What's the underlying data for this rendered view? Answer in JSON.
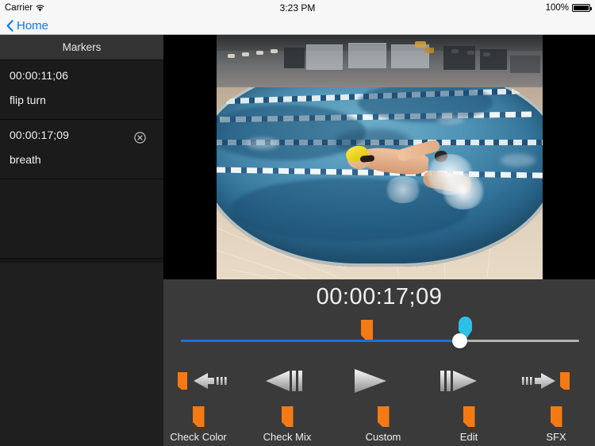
{
  "status_bar": {
    "carrier": "Carrier",
    "wifi_icon": "wifi-icon",
    "time": "3:23 PM",
    "battery_percent": "100%",
    "battery_icon": "battery-full-icon"
  },
  "nav_bar": {
    "back_icon": "chevron-left-icon",
    "back_label": "Home"
  },
  "sidebar": {
    "header": "Markers",
    "markers": [
      {
        "timecode": "00:00:11;06",
        "label": "flip turn",
        "has_delete": false
      },
      {
        "timecode": "00:00:17;09",
        "label": "breath",
        "has_delete": true,
        "delete_icon": "circle-x-icon"
      }
    ]
  },
  "video": {
    "scene": "swimmer-freestyle-pool",
    "letterbox_color": "#000000"
  },
  "player": {
    "timecode": "00:00:17;09",
    "scrubber": {
      "position_percent": 70,
      "fill_color": "#1e6fd9",
      "track_color": "#b3b3b3",
      "playhead_flag_color": "#2cc0e8",
      "marker_flag_color": "#f57a14",
      "marker_flag_percent": 47
    },
    "transport": [
      {
        "name": "previous-marker-button",
        "icon": "flag-arrow-left-icon"
      },
      {
        "name": "step-backward-button",
        "icon": "arrow-left-bars-icon"
      },
      {
        "name": "play-button",
        "icon": "play-icon"
      },
      {
        "name": "step-forward-button",
        "icon": "bars-arrow-right-icon"
      },
      {
        "name": "next-marker-button",
        "icon": "bars-arrow-right-flag-icon"
      }
    ],
    "marker_buttons": [
      {
        "label": "Check Color",
        "icon": "orange-flag-icon"
      },
      {
        "label": "Check Mix",
        "icon": "orange-flag-icon"
      },
      {
        "label": "Custom",
        "icon": "orange-flag-icon"
      },
      {
        "label": "Edit",
        "icon": "orange-flag-icon"
      },
      {
        "label": "SFX",
        "icon": "orange-flag-icon"
      }
    ]
  },
  "colors": {
    "accent_orange": "#f57a14",
    "accent_cyan": "#2cc0e8",
    "accent_blue": "#1e6fd9",
    "ios_blue": "#007aff",
    "panel_bg": "#3a3a3a",
    "sidebar_bg": "#1b1b1b"
  }
}
